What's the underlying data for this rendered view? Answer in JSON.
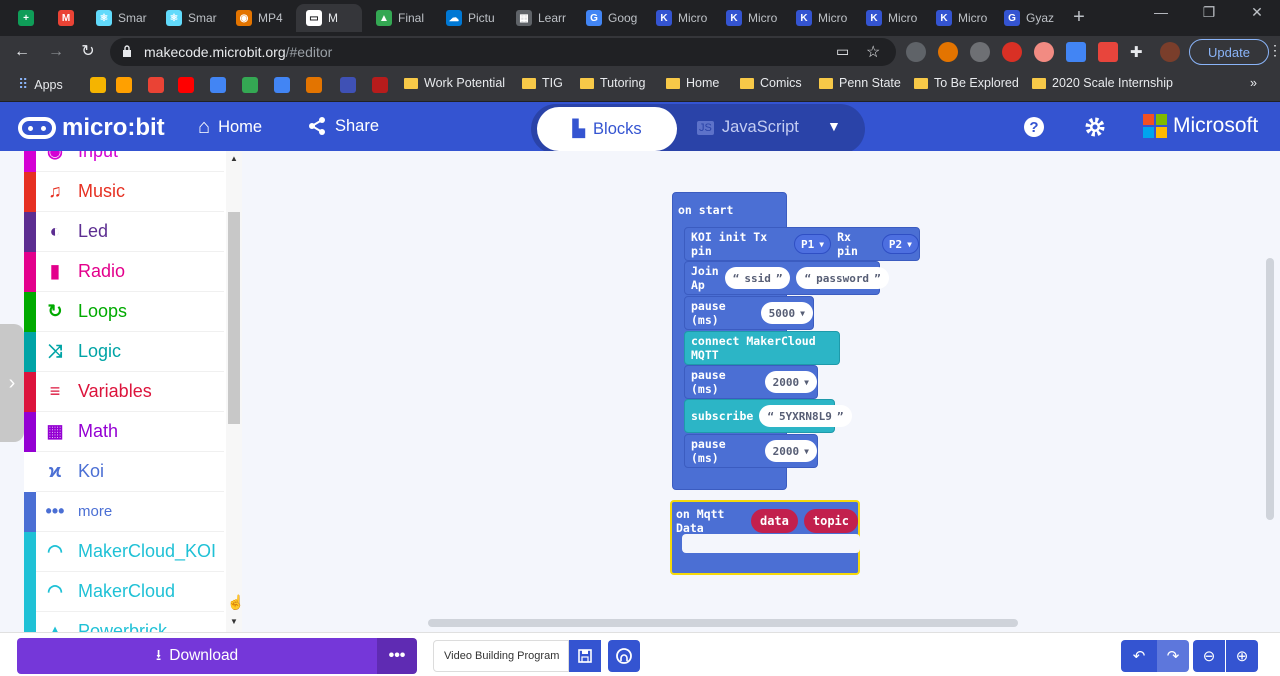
{
  "browser": {
    "tabs": [
      {
        "label": "",
        "color": "#0f9d58",
        "glyph": "+"
      },
      {
        "label": "",
        "color": "#ea4335",
        "glyph": "M"
      },
      {
        "label": "Smar",
        "color": "#61dafb",
        "glyph": "⚛"
      },
      {
        "label": "Smar",
        "color": "#61dafb",
        "glyph": "⚛"
      },
      {
        "label": "MP4",
        "color": "#e37400",
        "glyph": "◉"
      },
      {
        "label": "M",
        "color": "#ffffff",
        "glyph": "▭"
      },
      {
        "label": "Final",
        "color": "#34a853",
        "glyph": "▲"
      },
      {
        "label": "Pictu",
        "color": "#0078d4",
        "glyph": "☁"
      },
      {
        "label": "Learr",
        "color": "#5f6368",
        "glyph": "▦"
      },
      {
        "label": "Goog",
        "color": "#4285f4",
        "glyph": "G"
      },
      {
        "label": "Micro",
        "color": "#3454d1",
        "glyph": "K"
      },
      {
        "label": "Micro",
        "color": "#3454d1",
        "glyph": "K"
      },
      {
        "label": "Micro",
        "color": "#3454d1",
        "glyph": "K"
      },
      {
        "label": "Micro",
        "color": "#3454d1",
        "glyph": "K"
      },
      {
        "label": "Micro",
        "color": "#3454d1",
        "glyph": "K"
      },
      {
        "label": "Gyaz",
        "color": "#3454d1",
        "glyph": "G"
      }
    ],
    "url": {
      "host": "makecode.microbit.org",
      "path": "/#editor"
    },
    "update_label": "Update",
    "bookmarks": [
      {
        "label": "Apps",
        "type": "apps"
      },
      {
        "label": "Work Potential",
        "type": "folder"
      },
      {
        "label": "TIG",
        "type": "folder"
      },
      {
        "label": "Tutoring",
        "type": "folder"
      },
      {
        "label": "Home",
        "type": "folder"
      },
      {
        "label": "Comics",
        "type": "folder"
      },
      {
        "label": "Penn State",
        "type": "folder"
      },
      {
        "label": "To Be Explored",
        "type": "folder"
      },
      {
        "label": "2020 Scale Internship",
        "type": "folder"
      }
    ],
    "overflow_label": "»"
  },
  "header": {
    "logo_text": "micro:bit",
    "home_label": "Home",
    "share_label": "Share",
    "blocks_label": "Blocks",
    "javascript_label": "JavaScript",
    "microsoft_label": "Microsoft",
    "accent": "#3454d1"
  },
  "toolbox": {
    "categories": [
      {
        "label": "Input",
        "color": "#d400d4",
        "icon": "◉"
      },
      {
        "label": "Music",
        "color": "#e63022",
        "icon": "♫"
      },
      {
        "label": "Led",
        "color": "#5c2d91",
        "icon": "◐"
      },
      {
        "label": "Radio",
        "color": "#e3008c",
        "icon": "▮"
      },
      {
        "label": "Loops",
        "color": "#00aa00",
        "icon": "↻"
      },
      {
        "label": "Logic",
        "color": "#00a4a6",
        "icon": "⤨"
      },
      {
        "label": "Variables",
        "color": "#dc143c",
        "icon": "≡"
      },
      {
        "label": "Math",
        "color": "#9400d3",
        "icon": "▦"
      },
      {
        "label": "Koi",
        "color": "#4b6fd4",
        "icon": "ϰ"
      },
      {
        "label": "more",
        "color": "#4b6fd4",
        "icon": "•••"
      },
      {
        "label": "MakerCloud_KOI",
        "color": "#1fc1d6",
        "icon": "◠"
      },
      {
        "label": "MakerCloud",
        "color": "#1fc1d6",
        "icon": "◠"
      },
      {
        "label": "Powerbrick",
        "color": "#1fc1d6",
        "icon": "▲"
      }
    ]
  },
  "blocks": {
    "on_start": "on start",
    "koi_init": {
      "text": "KOI init Tx pin",
      "tx": "P1",
      "rx_text": "Rx pin",
      "rx": "P2"
    },
    "join_ap": {
      "text": "Join Ap",
      "ssid": "ssid",
      "password": "password"
    },
    "pause1": {
      "text": "pause (ms)",
      "value": "5000"
    },
    "connect": "connect MakerCloud MQTT",
    "pause2": {
      "text": "pause (ms)",
      "value": "2000"
    },
    "subscribe": {
      "text": "subscribe",
      "value": "5YXRN8L9"
    },
    "pause3": {
      "text": "pause (ms)",
      "value": "2000"
    },
    "on_mqtt": {
      "text": "on Mqtt Data",
      "arg1": "data",
      "arg2": "topic"
    },
    "colors": {
      "koi": "#4b6fd4",
      "cloud": "#2cb5c6",
      "var": "#c2204d",
      "highlight": "#f5d90a"
    }
  },
  "bottom": {
    "download_label": "Download",
    "more_label": "•••",
    "project_name": "Video Building Program"
  }
}
